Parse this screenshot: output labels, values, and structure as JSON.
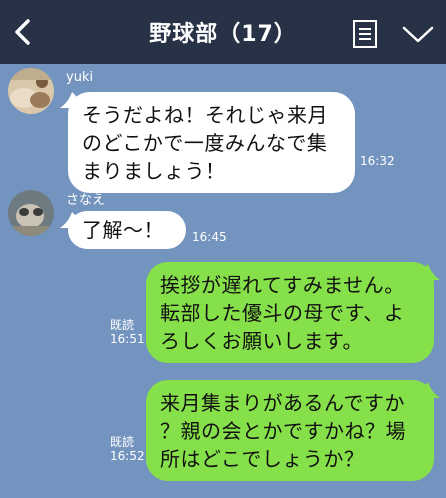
{
  "header": {
    "title": "野球部（17）",
    "back_icon": "chevron-left-icon",
    "menu_icon": "note-list-icon",
    "dropdown_icon": "chevron-down-icon",
    "bg_color": "#273246"
  },
  "chat": {
    "bg_color": "#7494c0",
    "messages": [
      {
        "sender": "yuki",
        "side": "left",
        "text": "そうだよね！それじゃ来月\nのどこかで一度みんなで集\nまりましょう！",
        "time": "16:32"
      },
      {
        "sender": "さなえ",
        "side": "left",
        "text": "了解～！",
        "time": "16:45"
      },
      {
        "side": "right",
        "text": "挨拶が遅れてすみません。\n転部した優斗の母です、よ\nろしくお願いします。",
        "read": "既読",
        "time": "16:51"
      },
      {
        "side": "right",
        "text": "来月集まりがあるんですか\n？親の会とかですかね？場\n所はどこでしょうか？",
        "read": "既読",
        "time": "16:52"
      }
    ]
  },
  "colors": {
    "left_bubble": "#ffffff",
    "right_bubble": "#86e04a"
  }
}
